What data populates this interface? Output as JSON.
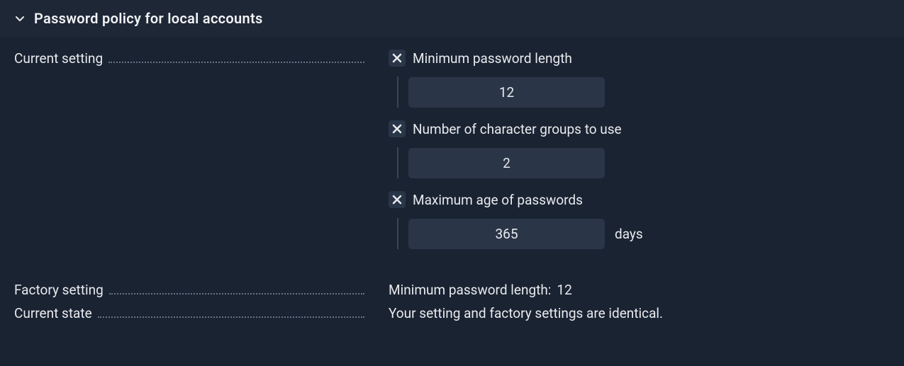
{
  "section": {
    "title": "Password policy for local accounts"
  },
  "labels": {
    "current_setting": "Current setting",
    "factory_setting": "Factory setting",
    "current_state": "Current state"
  },
  "policy": {
    "min_length": {
      "label": "Minimum password length",
      "value": "12"
    },
    "char_groups": {
      "label": "Number of character groups to use",
      "value": "2"
    },
    "max_age": {
      "label": "Maximum age of passwords",
      "value": "365",
      "unit": "days"
    }
  },
  "factory": {
    "label": "Minimum password length:",
    "value": "12"
  },
  "state": {
    "message": "Your setting and factory settings are identical."
  }
}
